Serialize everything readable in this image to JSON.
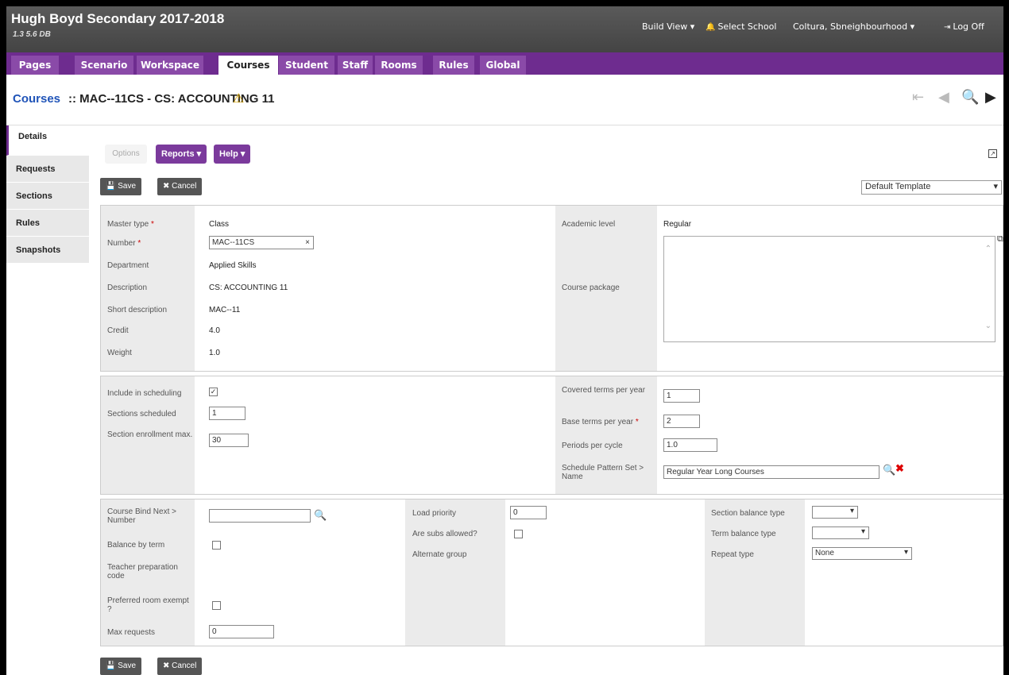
{
  "header": {
    "school_title": "Hugh Boyd Secondary 2017-2018",
    "version": "1.3 5.6 DB",
    "build_view": "Build View ▾",
    "select_school": "Select School",
    "user": "Coltura, Sbneighbourhood ▾",
    "log_off": "Log Off"
  },
  "nav": {
    "tabs": [
      "Pages",
      "Scenario",
      "Workspace",
      "Courses",
      "Student",
      "Staff",
      "Rooms",
      "Rules",
      "Global"
    ],
    "active": "Courses"
  },
  "title": {
    "root": "Courses",
    "rest": ":: MAC--11CS - CS: ACCOUNTING 11"
  },
  "side_tabs": [
    "Details",
    "Requests",
    "Sections",
    "Rules",
    "Snapshots"
  ],
  "toolbar": {
    "options": "Options",
    "reports": "Reports ▾",
    "help": "Help ▾",
    "save": "Save",
    "cancel": "Cancel",
    "template": "Default Template"
  },
  "panel1": {
    "master_type_label": "Master type",
    "master_type": "Class",
    "number_label": "Number",
    "number": "MAC--11CS",
    "department_label": "Department",
    "department": "Applied Skills",
    "description_label": "Description",
    "description": "CS: ACCOUNTING 11",
    "short_desc_label": "Short description",
    "short_desc": "MAC--11",
    "credit_label": "Credit",
    "credit": "4.0",
    "weight_label": "Weight",
    "weight": "1.0",
    "academic_level_label": "Academic level",
    "academic_level": "Regular",
    "course_package_label": "Course package"
  },
  "panel2": {
    "include_label": "Include in scheduling",
    "include_checked": true,
    "sections_scheduled_label": "Sections scheduled",
    "sections_scheduled": "1",
    "section_enroll_label": "Section enrollment max.",
    "section_enroll": "30",
    "covered_terms_label": "Covered terms per year",
    "covered_terms": "1",
    "base_terms_label": "Base terms per year",
    "base_terms": "2",
    "periods_label": "Periods per cycle",
    "periods": "1.0",
    "pattern_label": "Schedule Pattern Set > Name",
    "pattern": "Regular Year Long Courses"
  },
  "panel3": {
    "bind_label": "Course Bind Next > Number",
    "bind": "",
    "balance_term_label": "Balance by term",
    "teacher_prep_label": "Teacher preparation code",
    "preferred_room_label": "Preferred room exempt ?",
    "max_requests_label": "Max requests",
    "max_requests": "0",
    "load_priority_label": "Load priority",
    "load_priority": "0",
    "subs_label": "Are subs allowed?",
    "alternate_label": "Alternate group",
    "section_balance_label": "Section balance type",
    "term_balance_label": "Term balance type",
    "repeat_label": "Repeat type",
    "repeat": "None"
  }
}
